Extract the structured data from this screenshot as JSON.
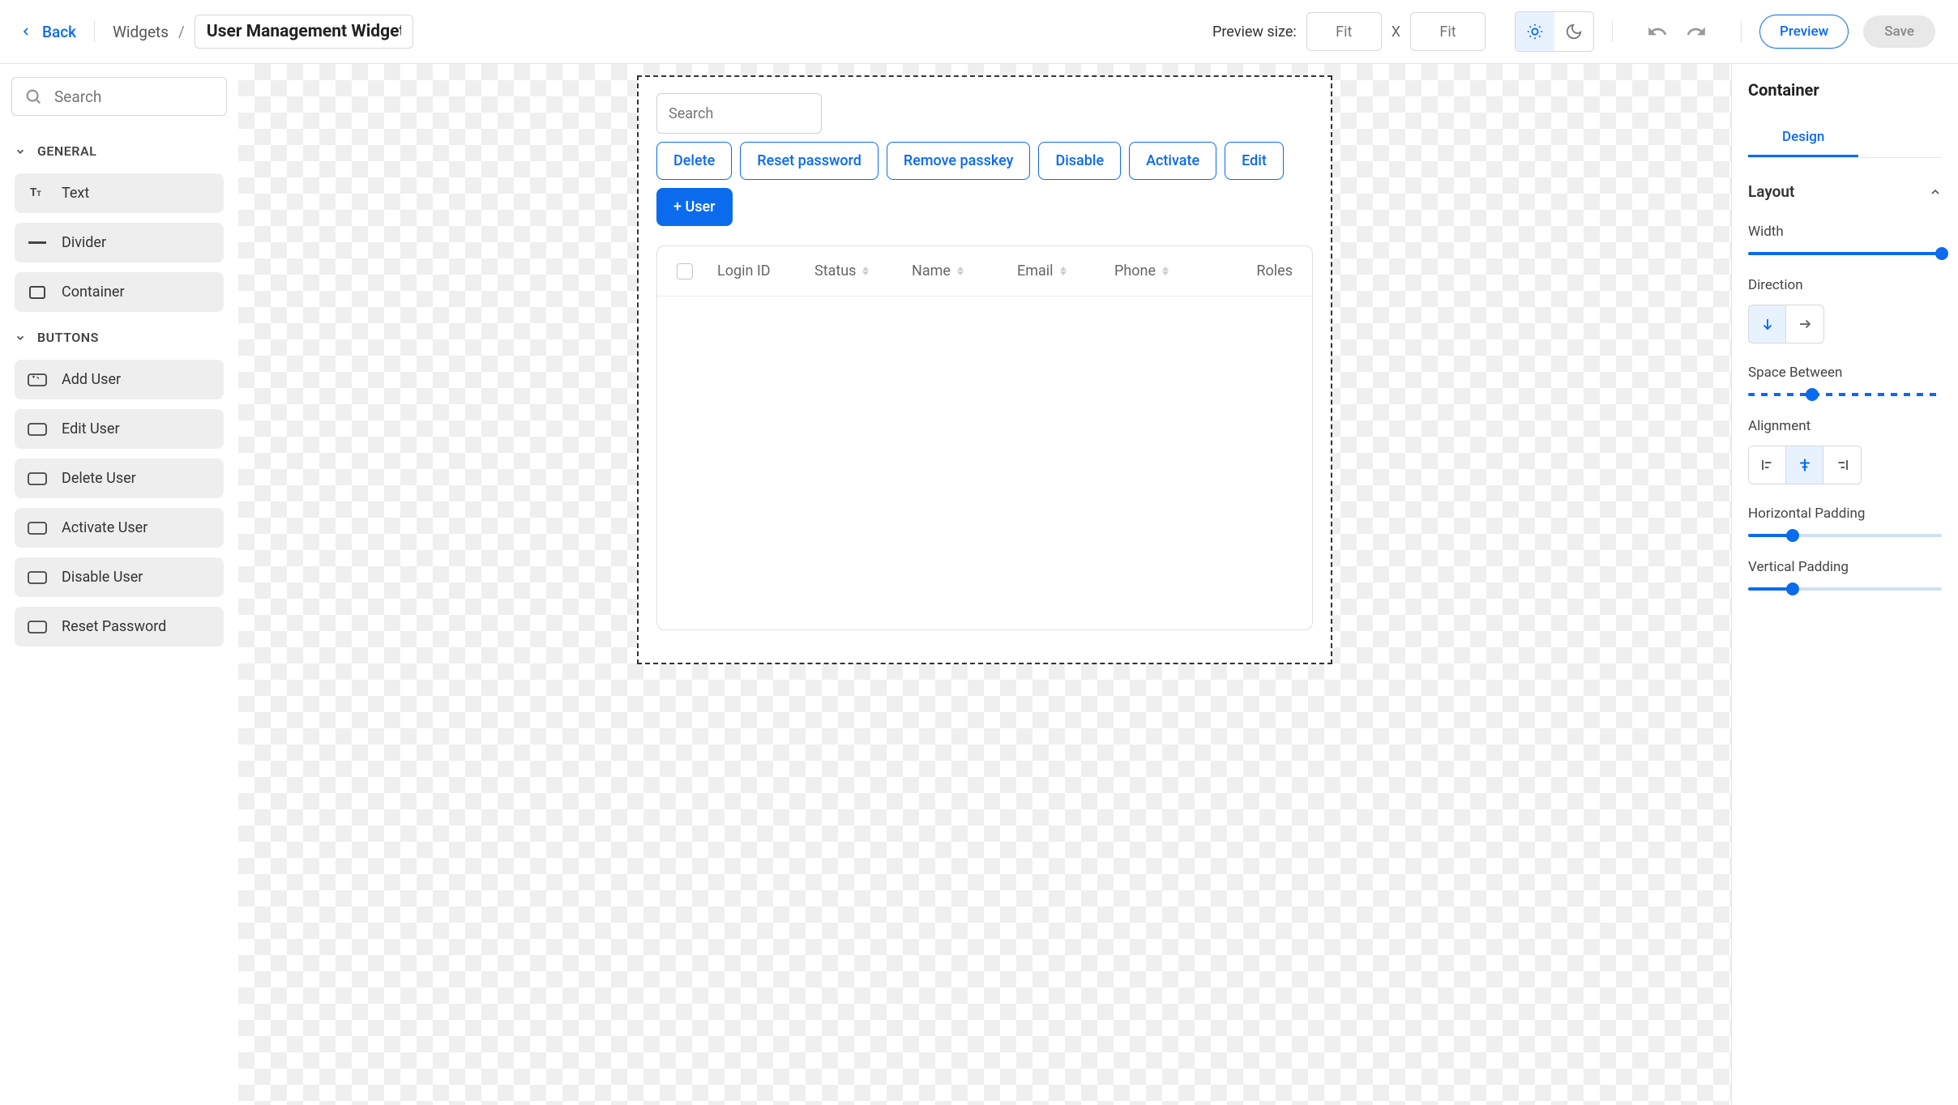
{
  "topbar": {
    "back": "Back",
    "breadcrumb": "Widgets",
    "slash": "/",
    "title": "User Management Widget",
    "preview_size_label": "Preview size:",
    "size_w_placeholder": "Fit",
    "size_h_placeholder": "Fit",
    "size_x": "X",
    "preview_btn": "Preview",
    "save_btn": "Save"
  },
  "sidebar": {
    "search_placeholder": "Search",
    "cat_general": "GENERAL",
    "general_items": [
      "Text",
      "Divider",
      "Container"
    ],
    "cat_buttons": "BUTTONS",
    "button_items": [
      "Add User",
      "Edit User",
      "Delete User",
      "Activate User",
      "Disable User",
      "Reset Password"
    ]
  },
  "canvas": {
    "search_placeholder": "Search",
    "buttons": [
      "Delete",
      "Reset password",
      "Remove passkey",
      "Disable",
      "Activate",
      "Edit",
      "+ User"
    ],
    "primary_index": 6,
    "columns": [
      "Login ID",
      "Status",
      "Name",
      "Email",
      "Phone",
      "Roles"
    ]
  },
  "rightpanel": {
    "title": "Container",
    "tab": "Design",
    "layout_section": "Layout",
    "width_label": "Width",
    "direction_label": "Direction",
    "space_between_label": "Space Between",
    "alignment_label": "Alignment",
    "hpad_label": "Horizontal Padding",
    "vpad_label": "Vertical Padding",
    "width_pct": 100,
    "space_pct": 33,
    "hpad_pct": 23,
    "vpad_pct": 23
  }
}
